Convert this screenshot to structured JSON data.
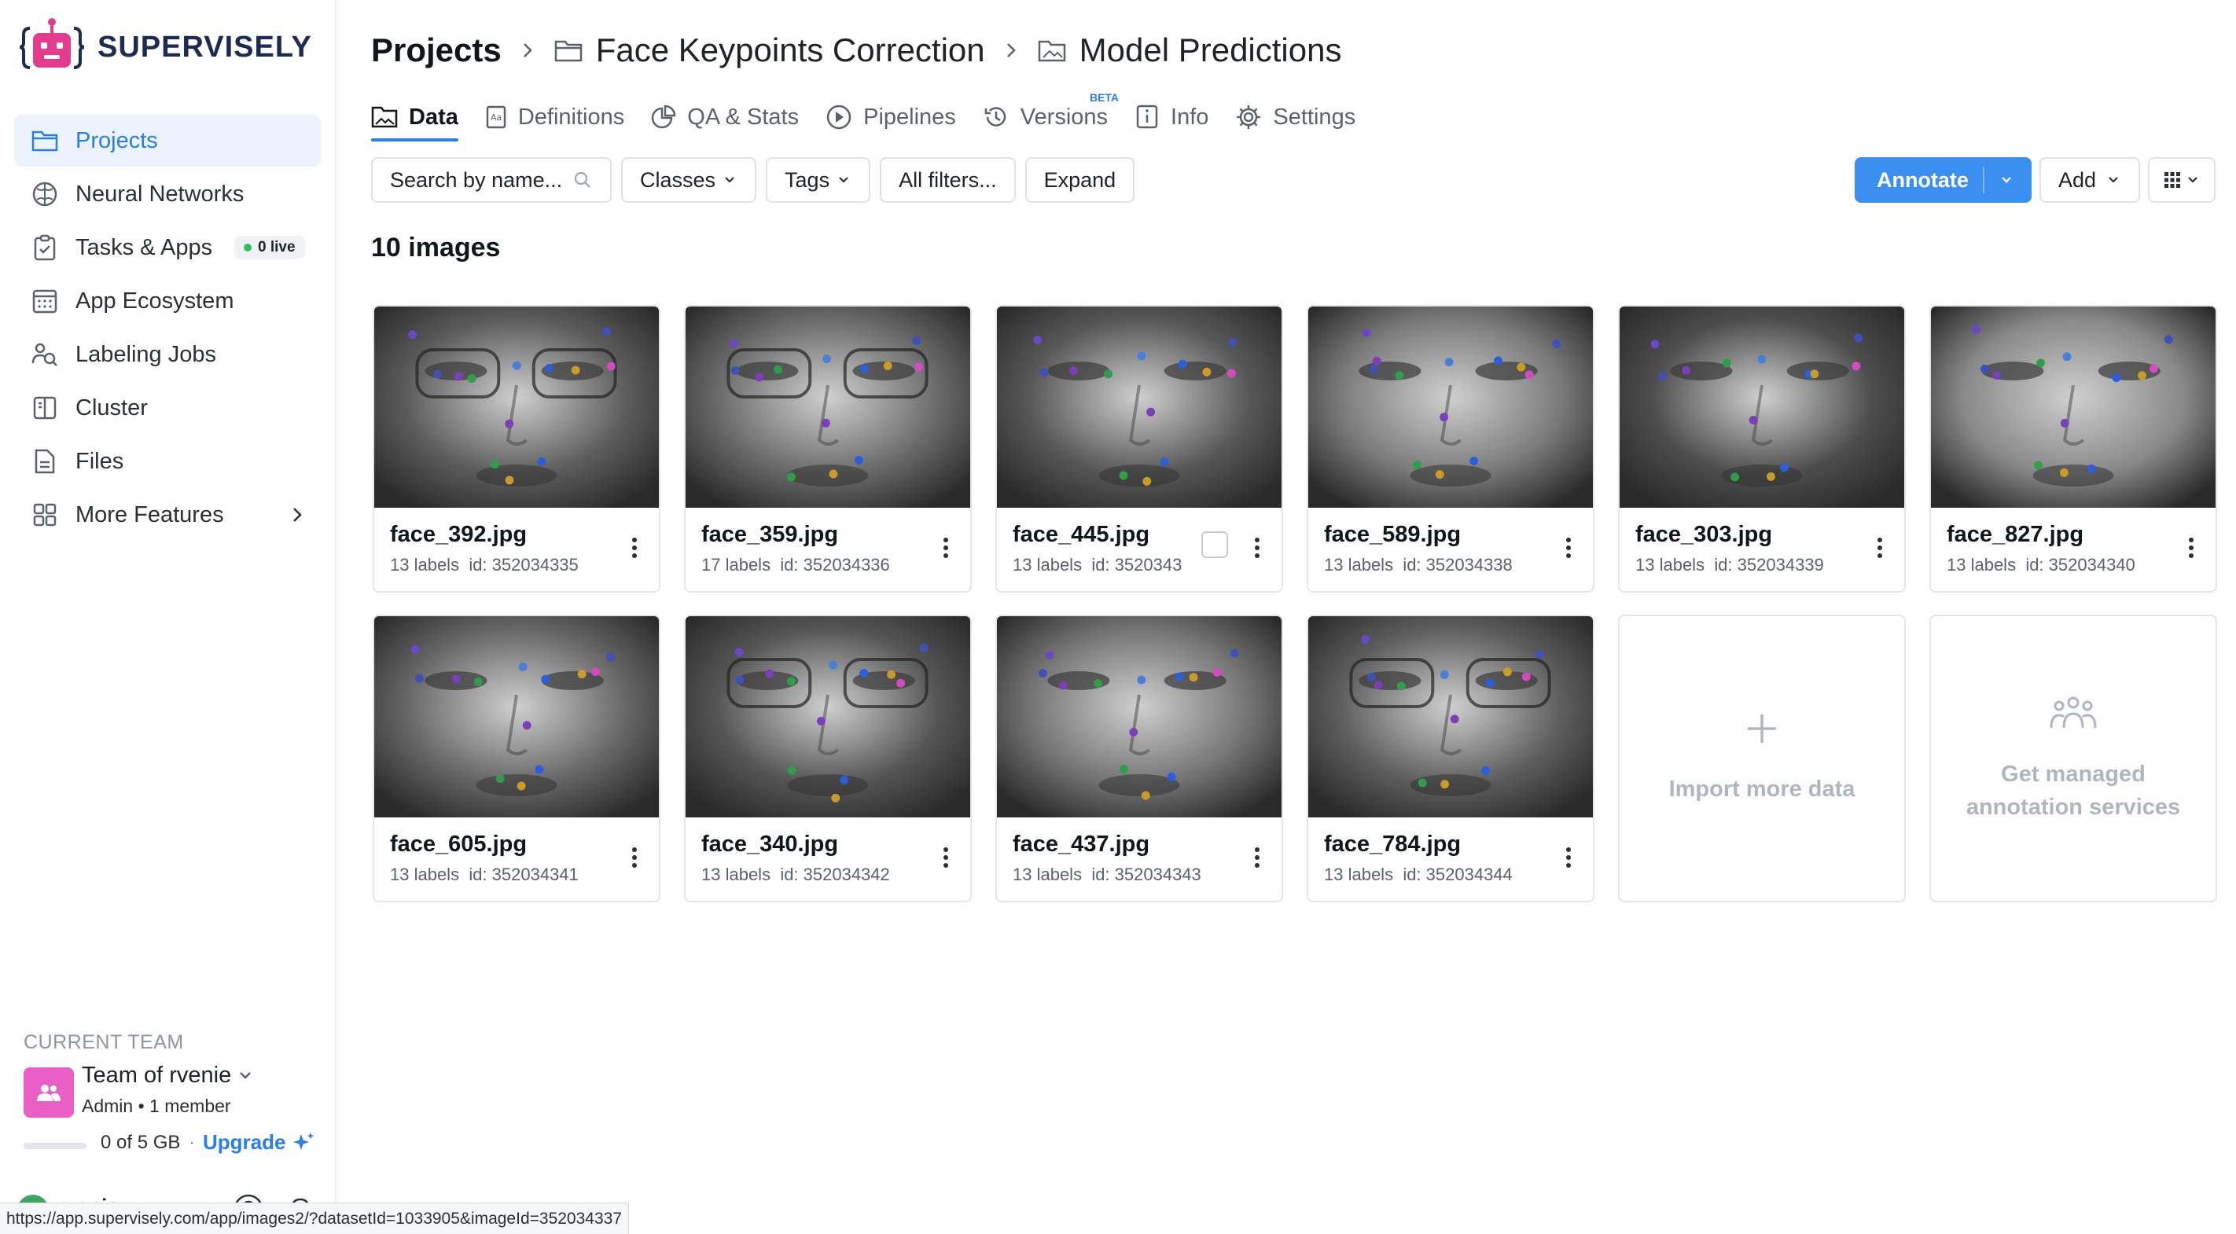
{
  "brand": {
    "name": "SUPERVISELY",
    "accent": "#e23d8d"
  },
  "sidebar": {
    "items": [
      {
        "label": "Projects",
        "icon": "folder-icon",
        "active": true
      },
      {
        "label": "Neural Networks",
        "icon": "brain-icon"
      },
      {
        "label": "Tasks & Apps",
        "icon": "clipboard-check-icon",
        "badge": "0 live"
      },
      {
        "label": "App Ecosystem",
        "icon": "calendar-grid-icon"
      },
      {
        "label": "Labeling Jobs",
        "icon": "people-search-icon"
      },
      {
        "label": "Cluster",
        "icon": "server-icon"
      },
      {
        "label": "Files",
        "icon": "file-icon"
      },
      {
        "label": "More Features",
        "icon": "grid-icon"
      }
    ],
    "team": {
      "section_label": "CURRENT TEAM",
      "name": "Team of rvenie",
      "role": "Admin • 1 member",
      "storage": "0 of 5 GB",
      "storage_used_fraction": 0.0,
      "upgrade_label": "Upgrade"
    },
    "user": {
      "initial": "r",
      "name": "rvenie"
    }
  },
  "breadcrumb": {
    "root": "Projects",
    "project": "Face Keypoints Correction",
    "dataset": "Model Predictions"
  },
  "tabs": [
    {
      "label": "Data",
      "icon": "image-icon",
      "active": true
    },
    {
      "label": "Definitions",
      "icon": "definitions-icon"
    },
    {
      "label": "QA & Stats",
      "icon": "pie-chart-icon"
    },
    {
      "label": "Pipelines",
      "icon": "play-circle-icon"
    },
    {
      "label": "Versions",
      "icon": "history-icon",
      "badge": "BETA"
    },
    {
      "label": "Info",
      "icon": "info-icon"
    },
    {
      "label": "Settings",
      "icon": "gear-icon"
    }
  ],
  "toolbar": {
    "search_placeholder": "Search by name...",
    "classes_label": "Classes",
    "tags_label": "Tags",
    "all_filters_label": "All filters...",
    "expand_label": "Expand",
    "annotate_label": "Annotate",
    "add_label": "Add"
  },
  "count_label": "10 images",
  "images": [
    {
      "name": "face_392.jpg",
      "labels": "13 labels",
      "id": "id: 352034335"
    },
    {
      "name": "face_359.jpg",
      "labels": "17 labels",
      "id": "id: 352034336"
    },
    {
      "name": "face_445.jpg",
      "labels": "13 labels",
      "id": "id: 3520343"
    },
    {
      "name": "face_589.jpg",
      "labels": "13 labels",
      "id": "id: 352034338"
    },
    {
      "name": "face_303.jpg",
      "labels": "13 labels",
      "id": "id: 352034339"
    },
    {
      "name": "face_827.jpg",
      "labels": "13 labels",
      "id": "id: 352034340"
    },
    {
      "name": "face_605.jpg",
      "labels": "13 labels",
      "id": "id: 352034341"
    },
    {
      "name": "face_340.jpg",
      "labels": "13 labels",
      "id": "id: 352034342"
    },
    {
      "name": "face_437.jpg",
      "labels": "13 labels",
      "id": "id: 352034343"
    },
    {
      "name": "face_784.jpg",
      "labels": "13 labels",
      "id": "id: 352034344"
    }
  ],
  "placeholders": {
    "import": "Import more data",
    "managed_line1": "Get managed",
    "managed_line2": "annotation services"
  },
  "status_url": "https://app.supervisely.com/app/images2/?datasetId=1033905&imageId=352034337"
}
